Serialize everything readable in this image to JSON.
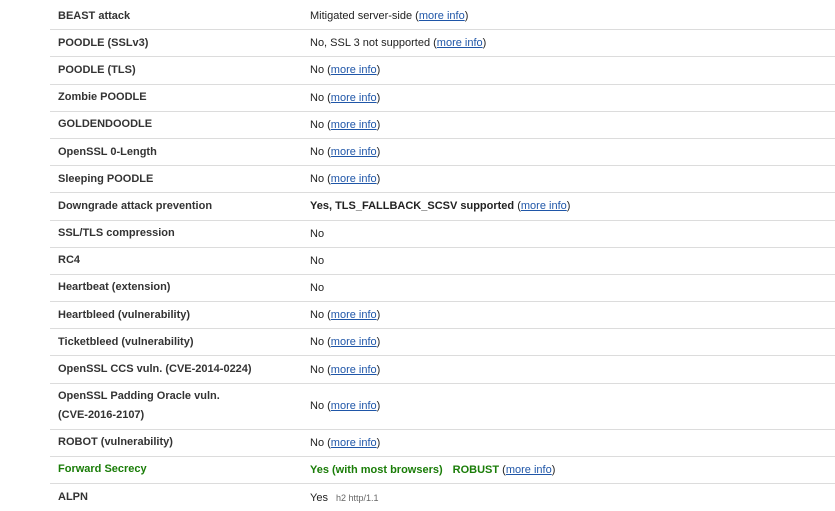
{
  "rows": [
    {
      "label": "BEAST attack",
      "text": "Mitigated server-side",
      "link": "more info"
    },
    {
      "label": "POODLE (SSLv3)",
      "text": "No, SSL 3 not supported",
      "link": "more info"
    },
    {
      "label": "POODLE (TLS)",
      "text": "No",
      "link": "more info"
    },
    {
      "label": "Zombie POODLE",
      "text": "No",
      "link": "more info"
    },
    {
      "label": "GOLDENDOODLE",
      "text": "No",
      "link": "more info"
    },
    {
      "label": "OpenSSL 0-Length",
      "text": "No",
      "link": "more info"
    },
    {
      "label": "Sleeping POODLE",
      "text": "No",
      "link": "more info"
    },
    {
      "label": "Downgrade attack prevention",
      "text": "Yes, TLS_FALLBACK_SCSV supported",
      "link": "more info"
    },
    {
      "label": "SSL/TLS compression",
      "text": "No"
    },
    {
      "label": "RC4",
      "text": "No"
    },
    {
      "label": "Heartbeat (extension)",
      "text": "No"
    },
    {
      "label": "Heartbleed (vulnerability)",
      "text": "No",
      "link": "more info"
    },
    {
      "label": "Ticketbleed (vulnerability)",
      "text": "No",
      "link": "more info"
    },
    {
      "label": "OpenSSL CCS vuln. (CVE-2014-0224)",
      "text": "No",
      "link": "more info"
    },
    {
      "label": "OpenSSL Padding Oracle vuln.",
      "label_line2": "(CVE-2016-2107)",
      "text": "No",
      "link": "more info"
    },
    {
      "label": "ROBOT (vulnerability)",
      "text": "No",
      "link": "more info"
    },
    {
      "label": "Forward Secrecy",
      "text": "Yes (with most browsers)",
      "text2": "ROBUST",
      "link": "more info"
    },
    {
      "label": "ALPN",
      "text": "Yes",
      "small": "h2 http/1.1"
    }
  ],
  "colors": {
    "green": "#1a7d08",
    "link": "#1f56a8",
    "divider": "#dcdcdc"
  }
}
